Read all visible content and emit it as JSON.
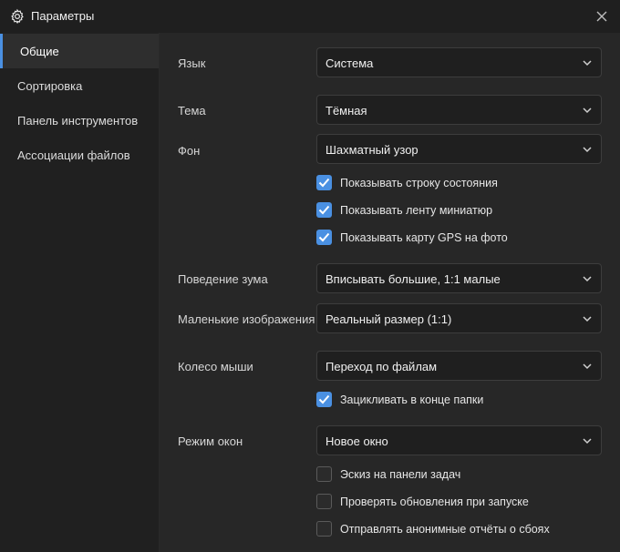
{
  "window": {
    "title": "Параметры"
  },
  "sidebar": {
    "items": [
      {
        "label": "Общие",
        "active": true
      },
      {
        "label": "Сортировка"
      },
      {
        "label": "Панель инструментов"
      },
      {
        "label": "Ассоциации файлов"
      }
    ]
  },
  "settings": {
    "language": {
      "label": "Язык",
      "value": "Система"
    },
    "theme": {
      "label": "Тема",
      "value": "Тёмная"
    },
    "background": {
      "label": "Фон",
      "value": "Шахматный узор"
    },
    "show_status_bar": {
      "label": "Показывать строку состояния",
      "checked": true
    },
    "show_thumbnail_strip": {
      "label": "Показывать ленту миниатюр",
      "checked": true
    },
    "show_gps_map": {
      "label": "Показывать карту GPS на фото",
      "checked": true
    },
    "zoom_behavior": {
      "label": "Поведение зума",
      "value": "Вписывать большие, 1:1 малые"
    },
    "small_images": {
      "label": "Маленькие изображения",
      "value": "Реальный размер (1:1)"
    },
    "mouse_wheel": {
      "label": "Колесо мыши",
      "value": "Переход по файлам"
    },
    "loop_folder": {
      "label": "Зацикливать в конце папки",
      "checked": true
    },
    "window_mode": {
      "label": "Режим окон",
      "value": "Новое окно"
    },
    "taskbar_thumbnail": {
      "label": "Эскиз на панели задач",
      "checked": false
    },
    "check_updates": {
      "label": "Проверять обновления при запуске",
      "checked": false
    },
    "send_crash_reports": {
      "label": "Отправлять анонимные отчёты о сбоях",
      "checked": false
    }
  },
  "colors": {
    "accent": "#4a90e2",
    "sidebar_bg": "#202020",
    "main_bg": "#272727",
    "input_bg": "#1f1f1f"
  }
}
